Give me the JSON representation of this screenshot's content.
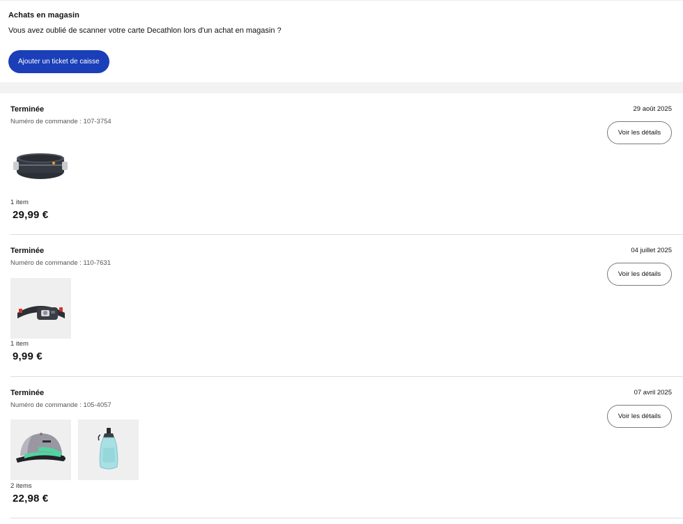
{
  "in_store": {
    "title": "Achats en magasin",
    "description": "Vous avez oublié de scanner votre carte Decathlon lors d'un achat en magasin ?",
    "button_label": "Ajouter un ticket de caisse"
  },
  "orders": [
    {
      "status": "Terminée",
      "number": "Numéro de commande : 107-3754",
      "date": "29 août 2025",
      "details_label": "Voir les détails",
      "items_label": "1 item",
      "total": "29,99 €",
      "products": [
        "running-belt-icon"
      ]
    },
    {
      "status": "Terminée",
      "number": "Numéro de commande : 110-7631",
      "date": "04 juillet 2025",
      "details_label": "Voir les détails",
      "items_label": "1 item",
      "total": "9,99 €",
      "products": [
        "headlamp-icon"
      ]
    },
    {
      "status": "Terminée",
      "number": "Numéro de commande : 105-4057",
      "date": "07 avril 2025",
      "details_label": "Voir les détails",
      "items_label": "2 items",
      "total": "22,98 €",
      "products": [
        "cap-icon",
        "soft-flask-icon"
      ]
    }
  ],
  "colors": {
    "primary_button": "#1a3fb8",
    "thumb_background": "#efefef",
    "cap_accent": "#4ed6a0"
  }
}
